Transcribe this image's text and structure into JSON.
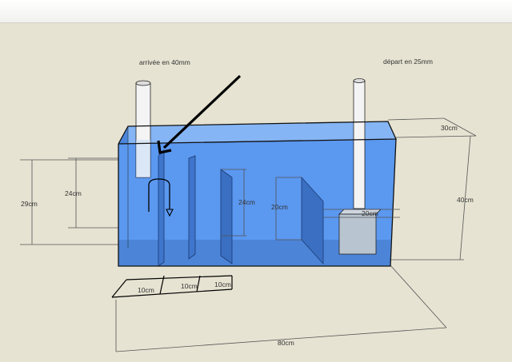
{
  "labels": {
    "inlet": "arrivée en 40mm",
    "outlet": "départ en 25mm",
    "depth": "30cm",
    "height_total": "40cm",
    "length_total": "80cm",
    "water_height": "29cm",
    "baffle_height_1": "24cm",
    "baffle_height_2": "24cm",
    "baffle_height_3": "20cm",
    "baffle_width": "20cm",
    "chamber_1": "10cm",
    "chamber_2": "10cm",
    "chamber_3": "10cm"
  },
  "colors": {
    "background": "#e6e3d2",
    "water": "#5b98f0",
    "glass_edge": "#111111",
    "pipe": "#f4f4f4"
  }
}
